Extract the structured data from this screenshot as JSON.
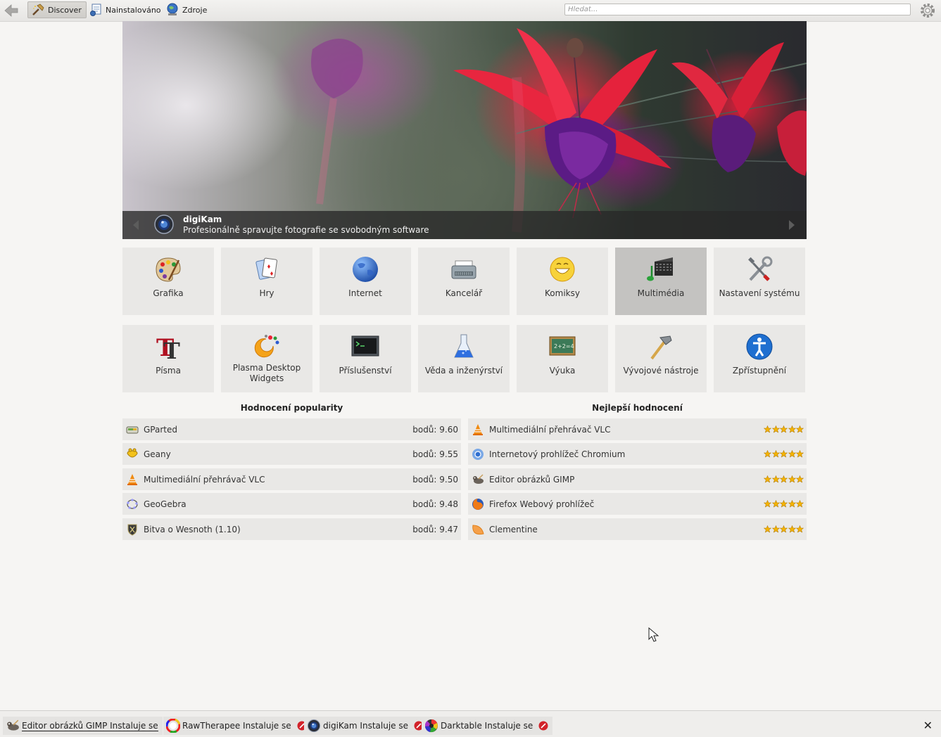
{
  "toolbar": {
    "tabs": [
      {
        "label": "Discover",
        "active": true,
        "icon": "discover-icon"
      },
      {
        "label": "Nainstalováno",
        "active": false,
        "icon": "installed-icon"
      },
      {
        "label": "Zdroje",
        "active": false,
        "icon": "sources-icon"
      }
    ],
    "search_placeholder": "Hledat..."
  },
  "banner": {
    "app_name": "digiKam",
    "description": "Profesionálně spravujte fotografie se svobodným software"
  },
  "categories": [
    {
      "label": "Grafika",
      "icon": "palette-icon",
      "selected": false
    },
    {
      "label": "Hry",
      "icon": "cards-icon",
      "selected": false
    },
    {
      "label": "Internet",
      "icon": "globe-icon",
      "selected": false
    },
    {
      "label": "Kancelář",
      "icon": "typewriter-icon",
      "selected": false
    },
    {
      "label": "Komiksy",
      "icon": "smiley-icon",
      "selected": false
    },
    {
      "label": "Multimédia",
      "icon": "multimedia-icon",
      "selected": true
    },
    {
      "label": "Nastavení systému",
      "icon": "tools-icon",
      "selected": false
    },
    {
      "label": "Písma",
      "icon": "fonts-icon",
      "selected": false
    },
    {
      "label": "Plasma Desktop Widgets",
      "icon": "plasma-icon",
      "selected": false
    },
    {
      "label": "Příslušenství",
      "icon": "terminal-icon",
      "selected": false
    },
    {
      "label": "Věda a inženýrství",
      "icon": "flask-icon",
      "selected": false
    },
    {
      "label": "Výuka",
      "icon": "chalkboard-icon",
      "selected": false
    },
    {
      "label": "Vývojové nástroje",
      "icon": "hammer-icon",
      "selected": false
    },
    {
      "label": "Zpřístupnění",
      "icon": "accessibility-icon",
      "selected": false
    }
  ],
  "popularity": {
    "title": "Hodnocení popularity",
    "items": [
      {
        "name": "GParted",
        "score": "bodů: 9.60",
        "icon": "gparted-icon"
      },
      {
        "name": "Geany",
        "score": "bodů: 9.55",
        "icon": "geany-icon"
      },
      {
        "name": "Multimediální přehrávač VLC",
        "score": "bodů: 9.50",
        "icon": "vlc-icon"
      },
      {
        "name": "GeoGebra",
        "score": "bodů: 9.48",
        "icon": "geogebra-icon"
      },
      {
        "name": "Bitva o Wesnoth (1.10)",
        "score": "bodů: 9.47",
        "icon": "wesnoth-icon"
      }
    ]
  },
  "top_rated": {
    "title": "Nejlepší hodnocení",
    "items": [
      {
        "name": "Multimediální přehrávač VLC",
        "stars": 5,
        "icon": "vlc-icon"
      },
      {
        "name": "Internetový prohlížeč Chromium",
        "stars": 5,
        "icon": "chromium-icon"
      },
      {
        "name": "Editor obrázků GIMP",
        "stars": 5,
        "icon": "gimp-icon"
      },
      {
        "name": "Firefox Webový prohlížeč",
        "stars": 5,
        "icon": "firefox-icon"
      },
      {
        "name": "Clementine",
        "stars": 5,
        "icon": "clementine-icon"
      }
    ]
  },
  "jobs": [
    {
      "label": "Editor obrázků GIMP Instaluje se",
      "icon": "gimp-icon",
      "cancelable": false
    },
    {
      "label": "RawTherapee Instaluje se",
      "icon": "rawtherapee-icon",
      "cancelable": true
    },
    {
      "label": "digiKam Instaluje se",
      "icon": "digikam-icon",
      "cancelable": true
    },
    {
      "label": "Darktable Instaluje se",
      "icon": "darktable-icon",
      "cancelable": true
    }
  ],
  "colors": {
    "accent_selected": "#c4c3c1",
    "tile": "#e9e8e6",
    "star": "#f5b400",
    "cancel": "#d2232a"
  }
}
